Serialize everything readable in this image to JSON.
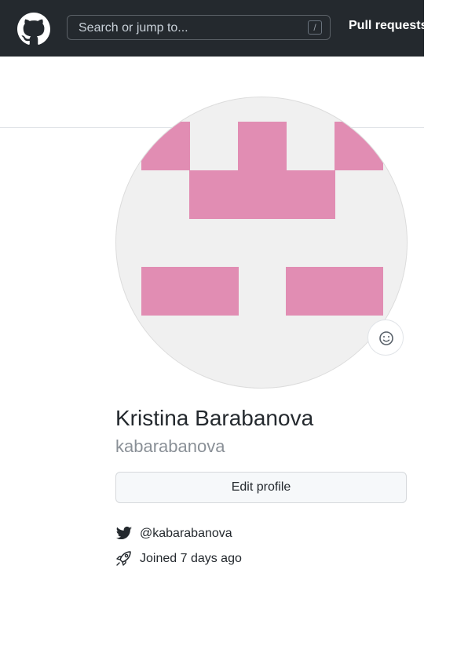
{
  "header": {
    "logo_icon": "github-mark-icon",
    "search_placeholder": "Search or jump to...",
    "search_shortcut": "/",
    "nav_pull_requests": "Pull requests"
  },
  "profile": {
    "avatar_colors": {
      "accent": "#e18db3",
      "background": "#f0f0f0"
    },
    "status_icon": "smiley-icon",
    "full_name": "Kristina Barabanova",
    "username": "kabarabanova",
    "edit_profile_label": "Edit profile",
    "twitter_icon": "twitter-bird-icon",
    "twitter_handle": "@kabarabanova",
    "joined_icon": "rocket-icon",
    "joined_text": "Joined 7 days ago"
  }
}
